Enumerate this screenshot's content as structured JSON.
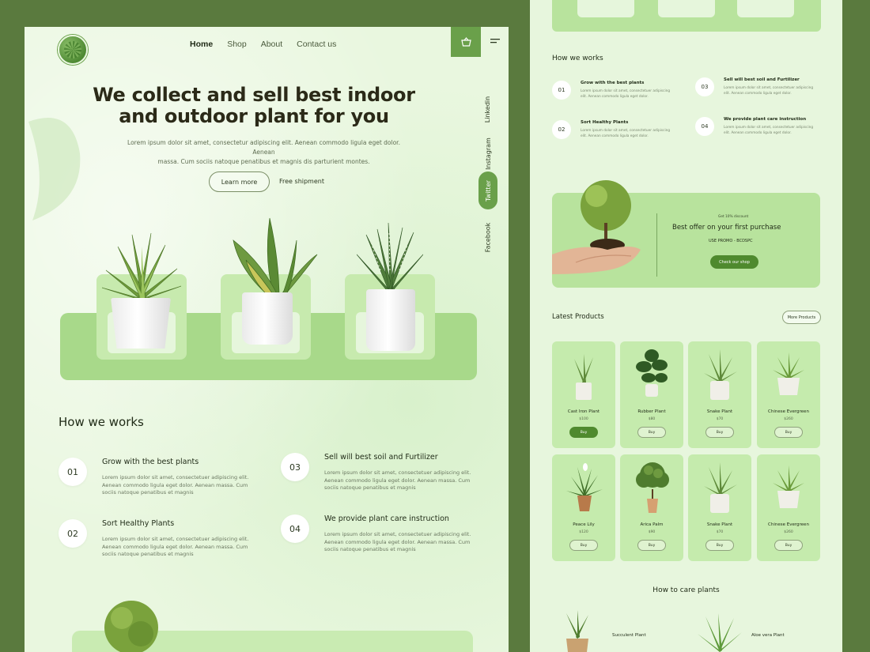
{
  "left": {
    "nav": [
      "Home",
      "Shop",
      "About",
      "Contact us"
    ],
    "hero": {
      "title_line1": "We collect and sell best indoor",
      "title_line2": "and outdoor plant for you",
      "desc_line1": "Lorem ipsum dolor sit amet, consectetur adipiscing elit. Aenean commodo ligula eget dolor. Aenean",
      "desc_line2": "massa. Cum sociis natoque penatibus et magnis dis parturient montes.",
      "learn_more": "Learn more",
      "free_shipment": "Free shipment"
    },
    "socials": [
      "Linkedin",
      "Instagram",
      "Twitter",
      "Facebook"
    ],
    "how": {
      "title": "How we works",
      "steps": [
        {
          "num": "01",
          "title": "Grow with the best plants",
          "text": "Lorem ipsum dolor sit amet, consectetuer adipiscing elit. Aenean commodo ligula eget dolor. Aenean massa. Cum sociis natoque penatibus et magnis"
        },
        {
          "num": "03",
          "title": "Sell will best soil and Furtilizer",
          "text": "Lorem ipsum dolor sit amet, consectetuer adipiscing elit. Aenean commodo ligula eget dolor. Aenean massa. Cum sociis natoque penatibus et magnis"
        },
        {
          "num": "02",
          "title": "Sort Healthy Plants",
          "text": "Lorem ipsum dolor sit amet, consectetuer adipiscing elit. Aenean commodo ligula eget dolor. Aenean massa. Cum sociis natoque penatibus et magnis"
        },
        {
          "num": "04",
          "title": "We provide plant care instruction",
          "text": "Lorem ipsum dolor sit amet, consectetuer adipiscing elit. Aenean commodo ligula eget dolor. Aenean massa. Cum sociis natoque penatibus et magnis"
        }
      ]
    }
  },
  "right": {
    "how": {
      "title": "How we works",
      "steps": [
        {
          "num": "01",
          "title": "Grow with the best plants",
          "text": "Lorem ipsum dolor sit amet, consectetuer adipiscing elit. Aenean commodo ligula eget dolor."
        },
        {
          "num": "03",
          "title": "Sell will best soil and Furtilizer",
          "text": "Lorem ipsum dolor sit amet, consectetuer adipiscing elit. Aenean commodo ligula eget dolor."
        },
        {
          "num": "02",
          "title": "Sort Healthy Plants",
          "text": "Lorem ipsum dolor sit amet, consectetuer adipiscing elit. Aenean commodo ligula eget dolor."
        },
        {
          "num": "04",
          "title": "We provide plant care instruction",
          "text": "Lorem ipsum dolor sit amet, consectetuer adipiscing elit. Aenean commodo ligula eget dolor."
        }
      ]
    },
    "offer": {
      "small": "Get 10% discount",
      "title": "Best offer on your first purchase",
      "promo": "USE PROMO - BCDSPC",
      "button": "Check our shop"
    },
    "latest": {
      "title": "Latest Products",
      "more": "More Products",
      "products": [
        {
          "name": "Cast Iron Plant",
          "price": "$100",
          "buy": "Buy"
        },
        {
          "name": "Rubber Plant",
          "price": "$80",
          "buy": "Buy"
        },
        {
          "name": "Snake Plant",
          "price": "$70",
          "buy": "Buy"
        },
        {
          "name": "Chinese Evergreen",
          "price": "$260",
          "buy": "Buy"
        },
        {
          "name": "Peace Lily",
          "price": "$120",
          "buy": "Buy"
        },
        {
          "name": "Arica Palm",
          "price": "$90",
          "buy": "Buy"
        },
        {
          "name": "Snake Plant",
          "price": "$70",
          "buy": "Buy"
        },
        {
          "name": "Chinese Evergreen",
          "price": "$260",
          "buy": "Buy"
        }
      ]
    },
    "care": {
      "title": "How to care plants",
      "items": [
        "Succulent Plant",
        "Aloe vera Plant"
      ]
    }
  },
  "colors": {
    "accent": "#6aa04a",
    "dark_accent": "#4f8a2e",
    "panel_bg": "#e9f7df",
    "outer_bg": "#5a7a3e"
  }
}
